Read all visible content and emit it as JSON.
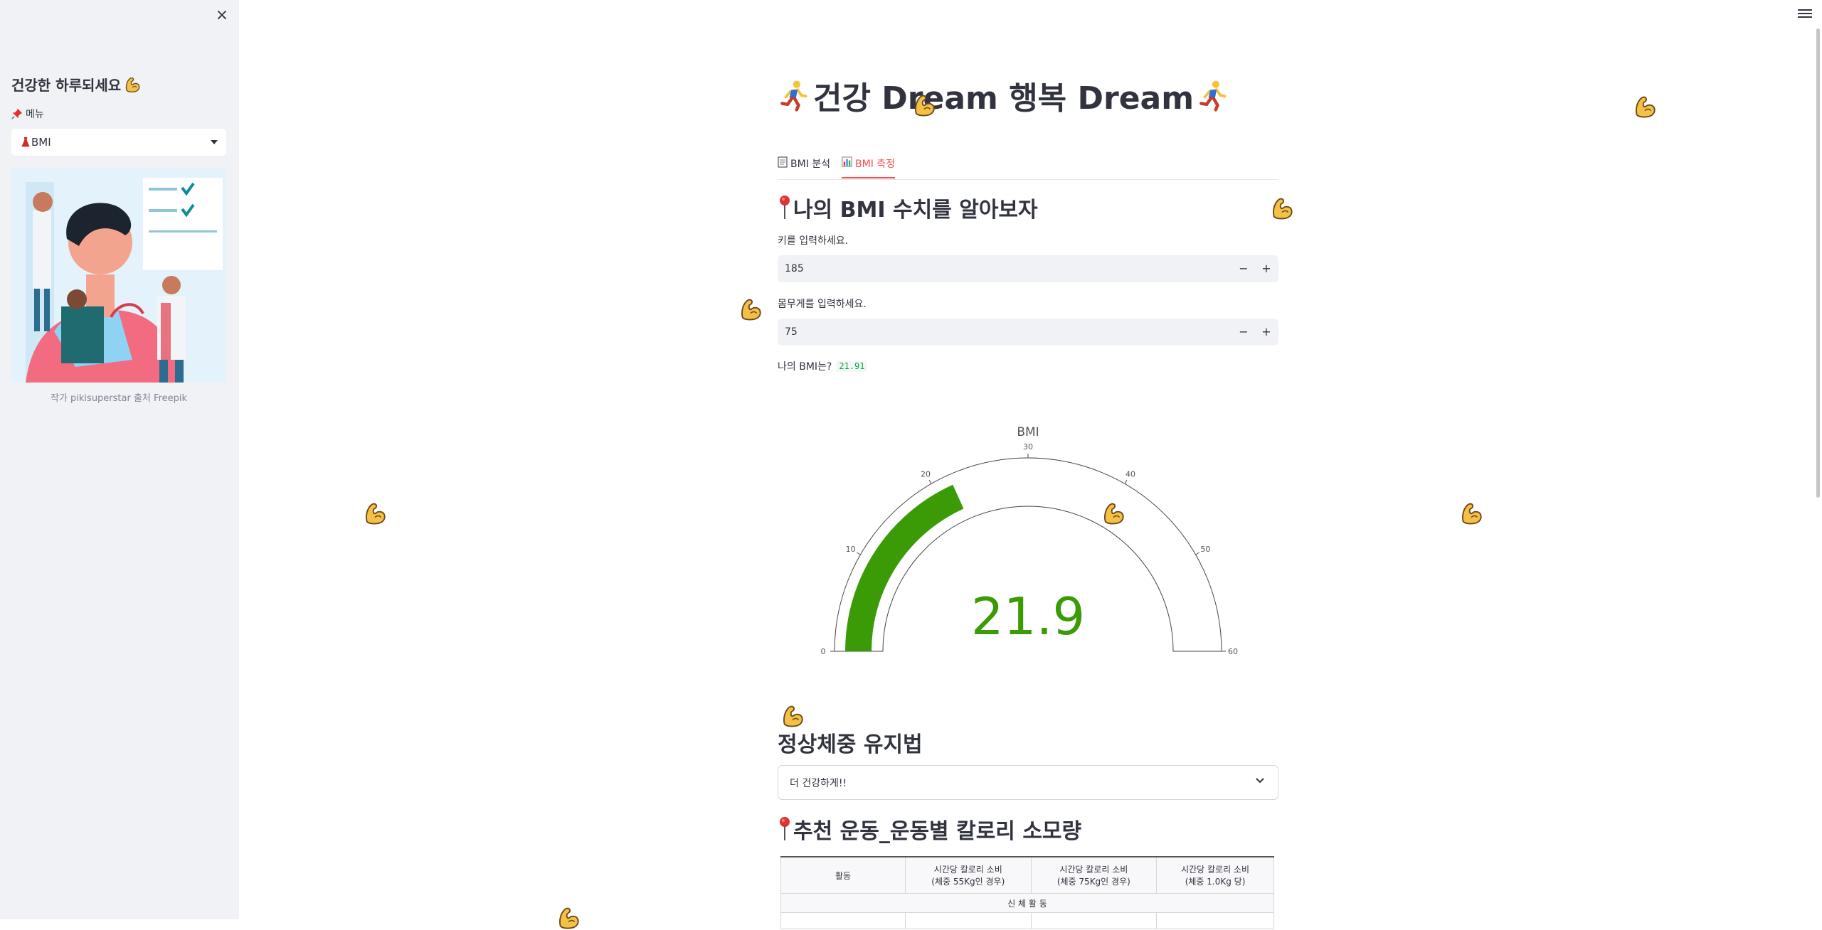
{
  "sidebar": {
    "close_label": "×",
    "title": "건강한 하루되세요",
    "menu_label": "메뉴",
    "select_value": "BMI",
    "image_caption": "작가 pikisuperstar 출처 Freepik"
  },
  "main": {
    "title": "건강 Dream 행복 Dream",
    "tabs": [
      {
        "label": "BMI 분석",
        "active": false
      },
      {
        "label": "BMI 측정",
        "active": true
      }
    ],
    "bmi_section": {
      "heading": "나의 BMI 수치를 알아보자",
      "height_label": "키를 입력하세요.",
      "height_value": "185",
      "weight_label": "몸무게를 입력하세요.",
      "weight_value": "75",
      "result_label": "나의 BMI는?",
      "result_value": "21.91"
    },
    "stepper": {
      "minus": "−",
      "plus": "+"
    },
    "maintain_heading": "정상체중 유지법",
    "expander_label": "더 건강하게!!",
    "exercise_heading": "추천 운동_운동별 칼로리 소모량",
    "table": {
      "headers": [
        "활동",
        [
          "시간당 칼로리 소비",
          "(체중 55Kg인 경우)"
        ],
        [
          "시간당 칼로리 소비",
          "(체중 75Kg인 경우)"
        ],
        [
          "시간당 칼로리 소비",
          "(체중 1.0Kg 당)"
        ]
      ],
      "section_label": "신 체 활 동"
    }
  },
  "chart_data": {
    "type": "gauge",
    "title": "BMI",
    "value": 21.9,
    "value_label": "21.9",
    "range": [
      0,
      60
    ],
    "ticks": [
      "0",
      "10",
      "20",
      "30",
      "40",
      "50",
      "60"
    ],
    "bar_color": "#3a9b06"
  },
  "colors": {
    "accent": "#ff4b4b",
    "sidebar_bg": "#f0f2f6",
    "gauge_bar": "#3a9b06",
    "code_text": "#09ab3b"
  },
  "icons": {
    "sidebar_title": "flexed-biceps-icon",
    "menu": "pushpin-icon",
    "select": "dress-icon",
    "title": "running-person-icon",
    "tab_1": "page-icon",
    "tab_2": "bar-chart-icon",
    "heading": "round-pushpin-icon",
    "floating": "flexed-biceps-icon"
  }
}
